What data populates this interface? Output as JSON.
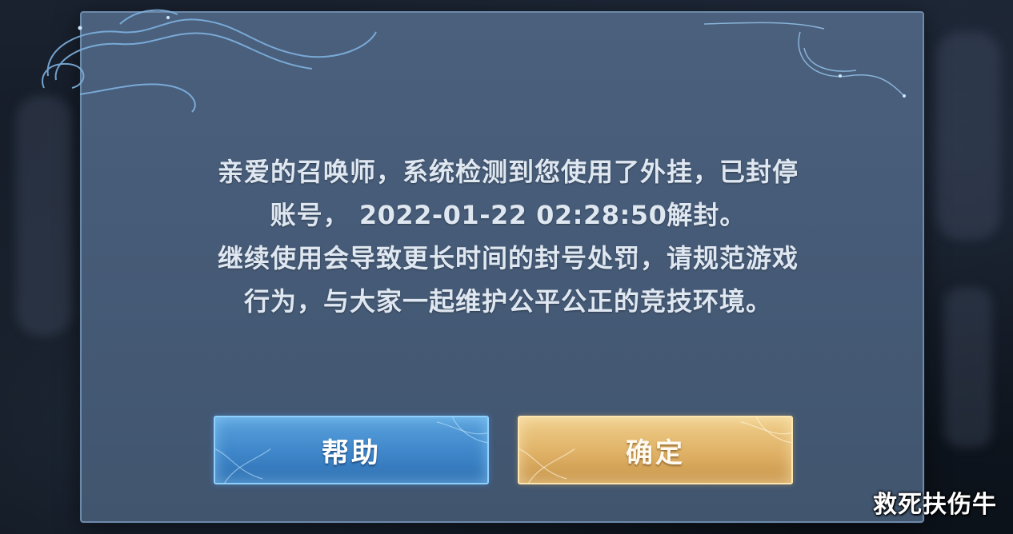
{
  "dialog": {
    "message_line1": "亲爱的召唤师，系统检测到您使用了外挂，已封停",
    "message_line2_prefix": "账号，",
    "unban_time": "2022-01-22 02:28:50",
    "message_line2_suffix": "解封。",
    "message_line3": "继续使用会导致更长时间的封号处罚，请规范游戏",
    "message_line4": "行为，与大家一起维护公平公正的竞技环境。",
    "help_label": "帮助",
    "confirm_label": "确定"
  },
  "watermark": "救死扶伤牛",
  "colors": {
    "panel": "#465b77",
    "panel_border": "#6e8aa9",
    "text": "#dfe7f1",
    "help_button": "#3e86c9",
    "confirm_button": "#dfb166"
  }
}
